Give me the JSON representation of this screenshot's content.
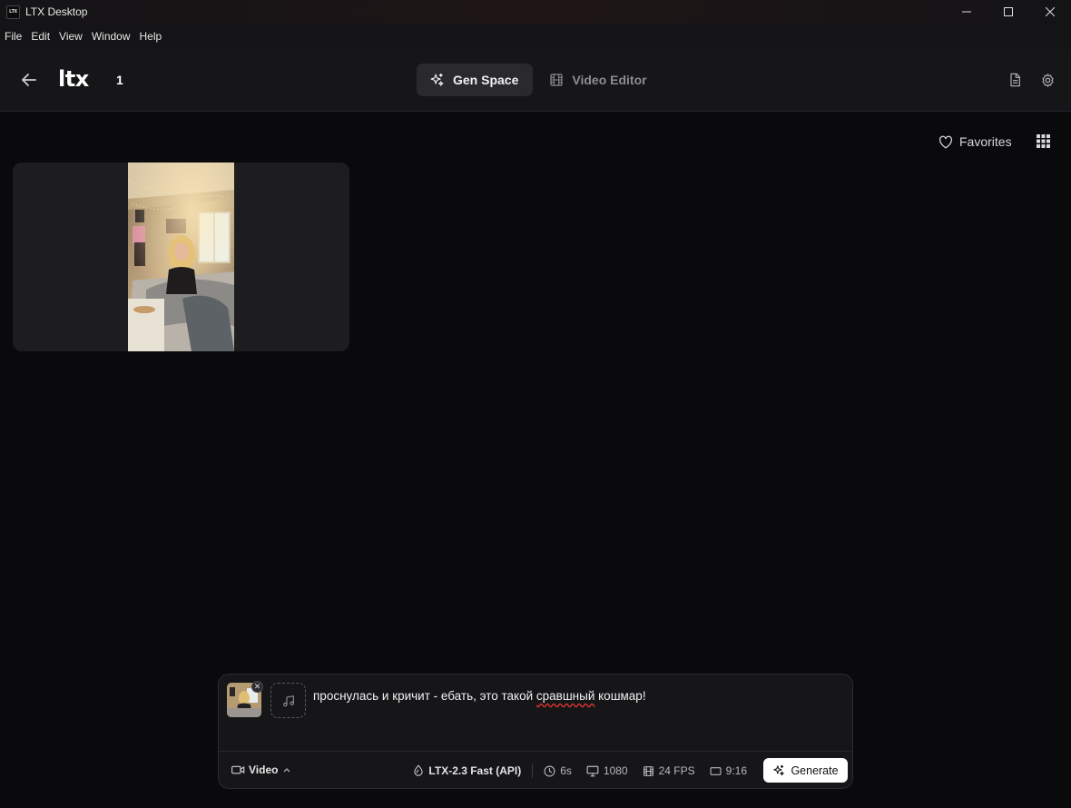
{
  "window": {
    "logo_text": "LTX",
    "title": "LTX Desktop"
  },
  "menu": [
    "File",
    "Edit",
    "View",
    "Window",
    "Help"
  ],
  "header": {
    "brand": "ltx",
    "project_name": "1",
    "tabs": [
      {
        "label": "Gen Space",
        "icon": "sparkles-icon",
        "active": true
      },
      {
        "label": "Video Editor",
        "icon": "film-icon",
        "active": false
      }
    ]
  },
  "gallery": {
    "favorites_label": "Favorites",
    "items": [
      {
        "type": "video",
        "aspect": "9:16"
      }
    ]
  },
  "composer": {
    "prompt_before": "проснулась и кричит - ебать, это такой ",
    "prompt_misspelled": "сравшный",
    "prompt_after": " кошмар!",
    "remove_glyph": "✕",
    "mode_label": "Video",
    "model": "LTX-2.3 Fast (API)",
    "duration": "6s",
    "resolution": "1080",
    "fps": "24 FPS",
    "aspect_ratio": "9:16",
    "generate_label": "Generate"
  },
  "colors": {
    "background": "#0a0a0c",
    "header": "#161618",
    "active_tab": "#2a2a2e",
    "generate_button": "#ffffff",
    "spellcheck": "#e0342c"
  }
}
